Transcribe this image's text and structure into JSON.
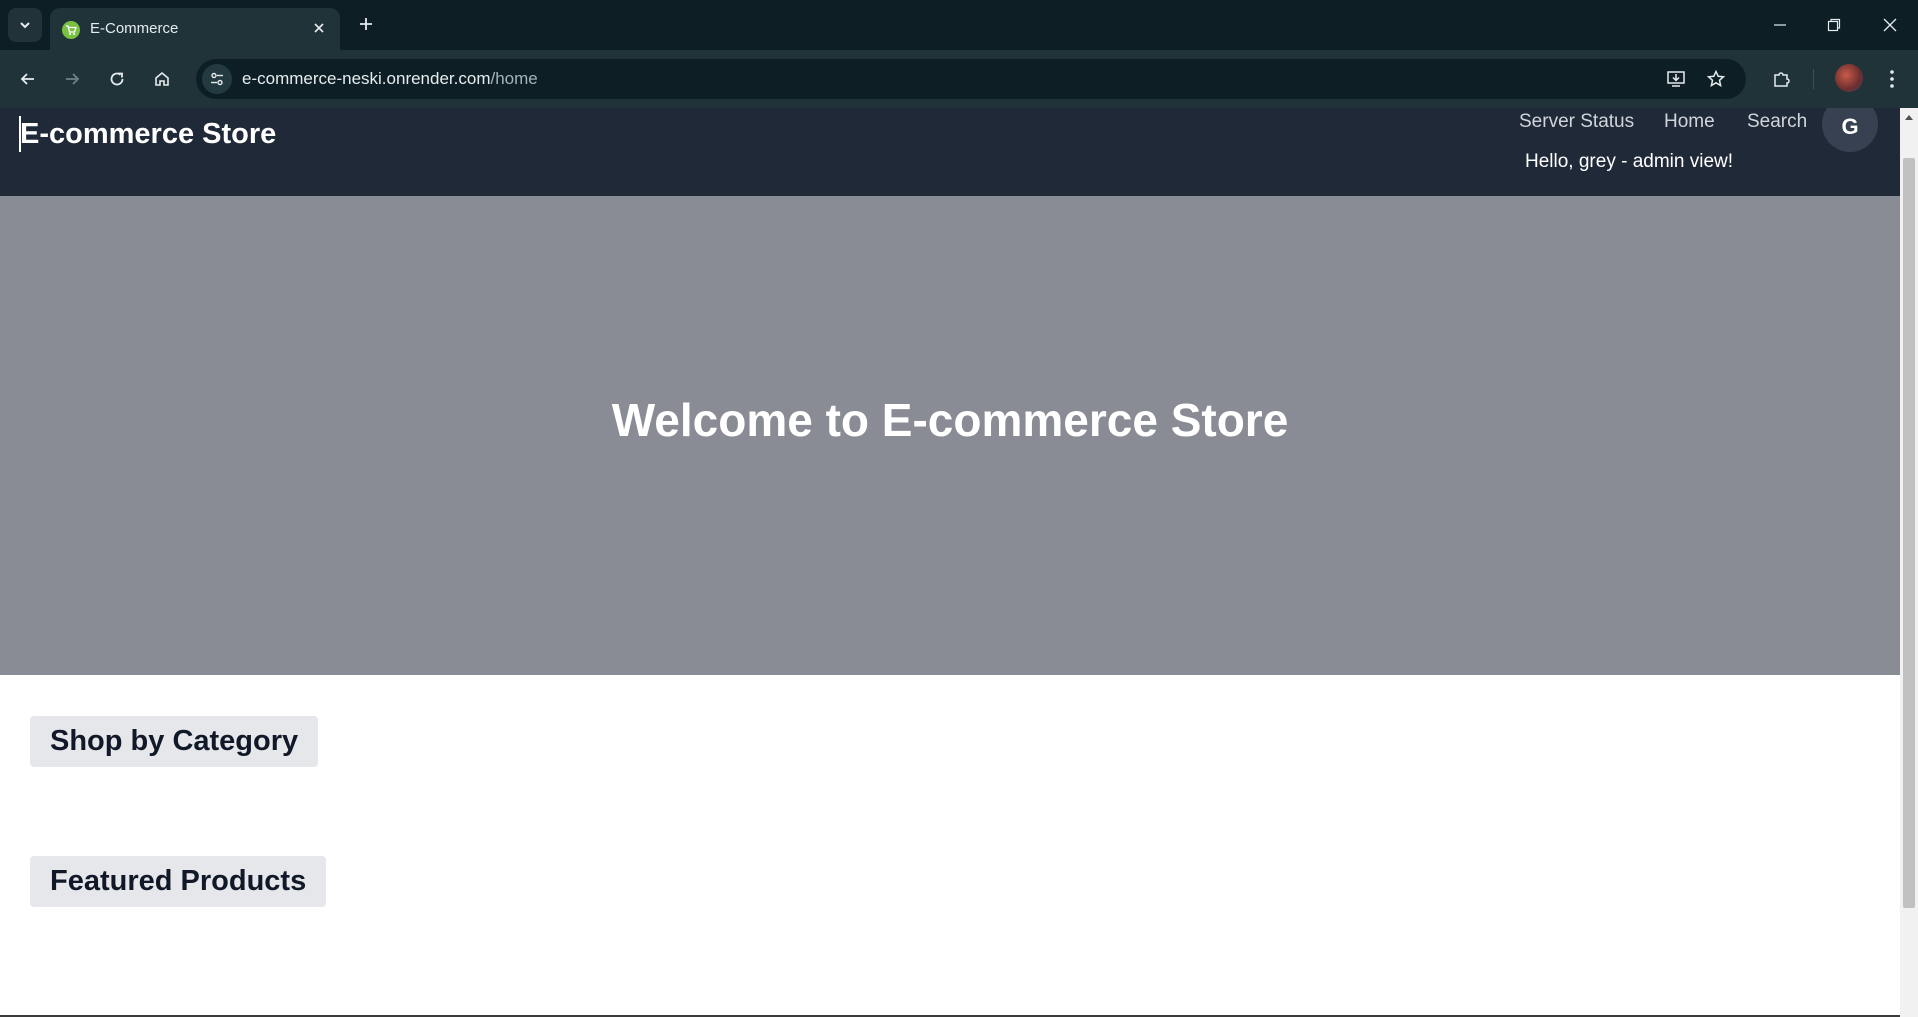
{
  "browser": {
    "tab_title": "E-Commerce",
    "url_host": "e-commerce-neski.onrender.com",
    "url_path": "/home",
    "icons": {
      "tab_search": "chevron-down-icon",
      "favicon": "shopping-cart-icon",
      "tab_close": "close-icon",
      "new_tab": "plus-icon",
      "back": "arrow-left-icon",
      "forward": "arrow-right-icon",
      "reload": "reload-icon",
      "home": "home-icon",
      "site_info": "tune-icon",
      "install": "install-app-icon",
      "bookmark": "star-icon",
      "extensions": "puzzle-icon",
      "menu": "kebab-menu-icon",
      "minimize": "minimize-icon",
      "restore": "restore-icon",
      "close": "close-icon"
    }
  },
  "header": {
    "brand": "E-commerce Store",
    "nav": {
      "server_status": "Server Status",
      "home": "Home",
      "search": "Search"
    },
    "greeting": "Hello, grey - admin view!",
    "avatar_letter": "G"
  },
  "hero": {
    "title": "Welcome to E-commerce Store"
  },
  "sections": {
    "category_heading": "Shop by Category",
    "featured_heading": "Featured Products"
  },
  "colors": {
    "header_bg": "#1f2937",
    "hero_bg": "#898b95",
    "heading_chip_bg": "#e5e7eb",
    "browser_frame": "#0d1f24"
  }
}
